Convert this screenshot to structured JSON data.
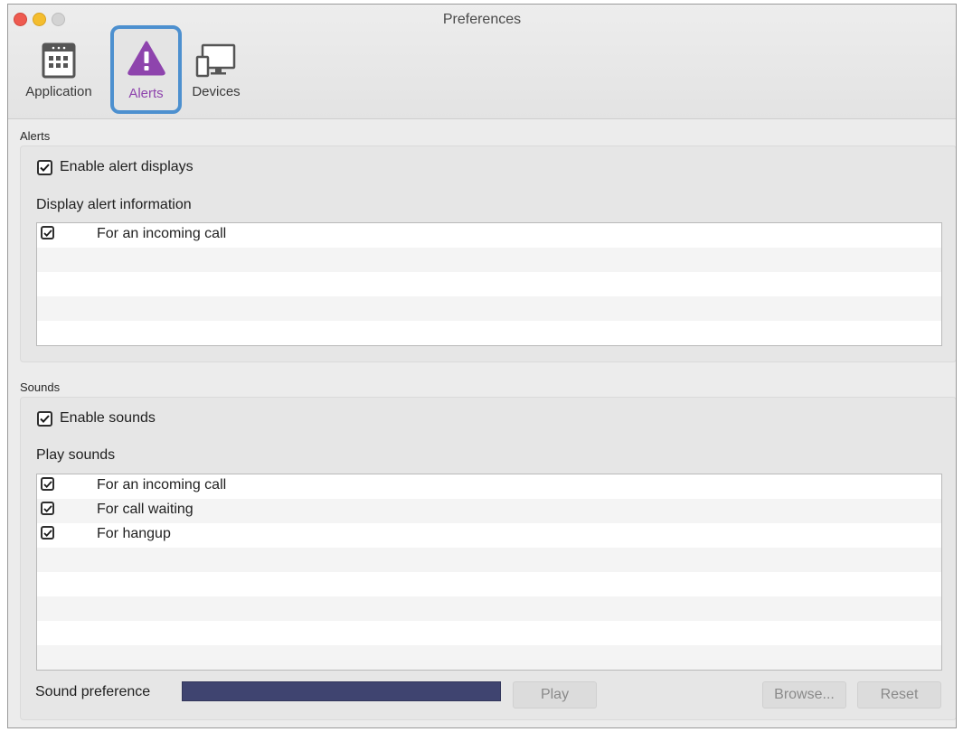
{
  "window": {
    "title": "Preferences"
  },
  "toolbar": {
    "items": [
      {
        "label": "Application",
        "icon": "calendar-icon"
      },
      {
        "label": "Alerts",
        "icon": "warning-triangle-icon",
        "selected": true
      },
      {
        "label": "Devices",
        "icon": "monitor-devices-icon"
      }
    ]
  },
  "colors": {
    "accent_selected": "#4d90cf",
    "alerts_purple": "#8e44ad",
    "sound_field": "#3f4470"
  },
  "alerts": {
    "section_label": "Alerts",
    "enable_label": "Enable alert displays",
    "enable_checked": true,
    "display_label": "Display alert information",
    "items": [
      {
        "label": "For an incoming call",
        "checked": true
      }
    ]
  },
  "sounds": {
    "section_label": "Sounds",
    "enable_label": "Enable sounds",
    "enable_checked": true,
    "play_label": "Play sounds",
    "items": [
      {
        "label": "For an incoming call",
        "checked": true
      },
      {
        "label": "For call waiting",
        "checked": true
      },
      {
        "label": "For hangup",
        "checked": true
      }
    ],
    "preference_label": "Sound preference",
    "play_button": "Play",
    "browse_button": "Browse...",
    "reset_button": "Reset"
  }
}
